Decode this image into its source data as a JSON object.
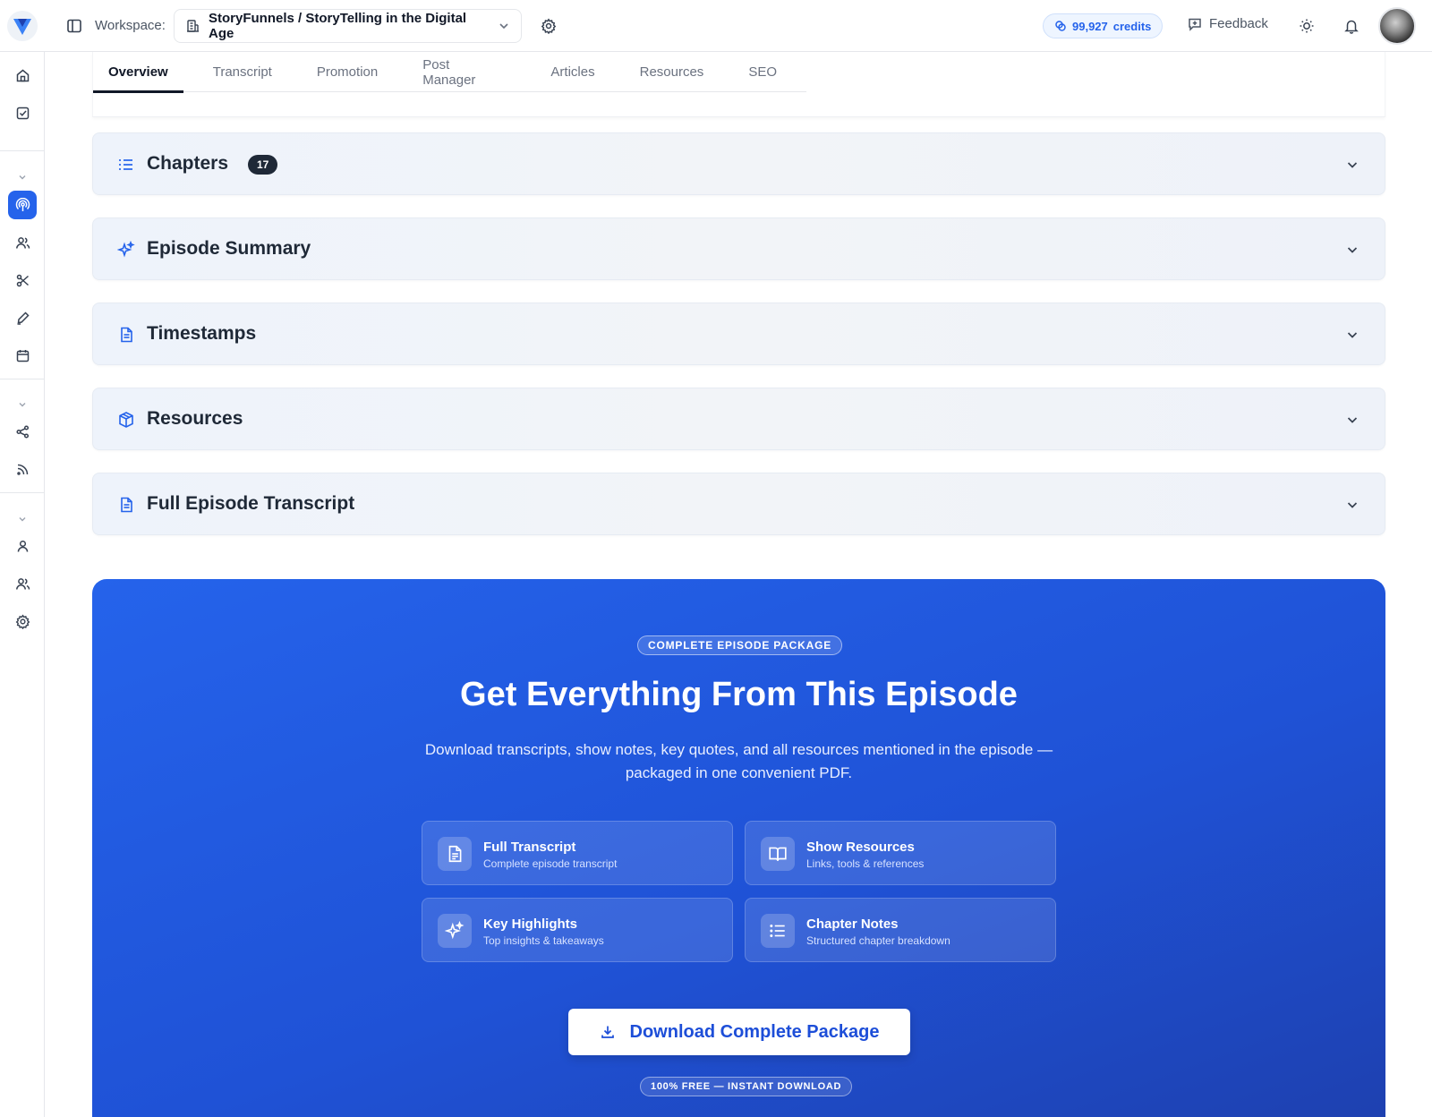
{
  "header": {
    "workspace_label": "Workspace:",
    "workspace_name": "StoryFunnels / StoryTelling in the Digital Age",
    "credits_value": "99,927",
    "credits_unit": "credits",
    "feedback_label": "Feedback"
  },
  "tabs": [
    {
      "label": "Overview",
      "active": true
    },
    {
      "label": "Transcript"
    },
    {
      "label": "Promotion"
    },
    {
      "label": "Post Manager"
    },
    {
      "label": "Articles"
    },
    {
      "label": "Resources"
    },
    {
      "label": "SEO"
    }
  ],
  "sections": [
    {
      "title": "Chapters",
      "badge": "17",
      "icon": "list-icon"
    },
    {
      "title": "Episode Summary",
      "icon": "sparkles-icon"
    },
    {
      "title": "Timestamps",
      "icon": "document-icon"
    },
    {
      "title": "Resources",
      "icon": "package-icon"
    },
    {
      "title": "Full Episode Transcript",
      "icon": "document-icon"
    }
  ],
  "promo": {
    "eyebrow": "COMPLETE EPISODE PACKAGE",
    "title": "Get Everything From This Episode",
    "description": "Download transcripts, show notes, key quotes, and all resources mentioned in the episode — packaged in one convenient PDF.",
    "features": [
      {
        "title": "Full Transcript",
        "subtitle": "Complete episode transcript",
        "icon": "document-icon"
      },
      {
        "title": "Show Resources",
        "subtitle": "Links, tools & references",
        "icon": "book-icon"
      },
      {
        "title": "Key Highlights",
        "subtitle": "Top insights & takeaways",
        "icon": "sparkles-icon"
      },
      {
        "title": "Chapter Notes",
        "subtitle": "Structured chapter breakdown",
        "icon": "list-icon"
      }
    ],
    "button_label": "Download Complete Package",
    "footnote": "100% FREE — INSTANT DOWNLOAD"
  },
  "colors": {
    "accent": "#2563eb",
    "promo_start": "#2563eb",
    "promo_end": "#1e40af"
  }
}
